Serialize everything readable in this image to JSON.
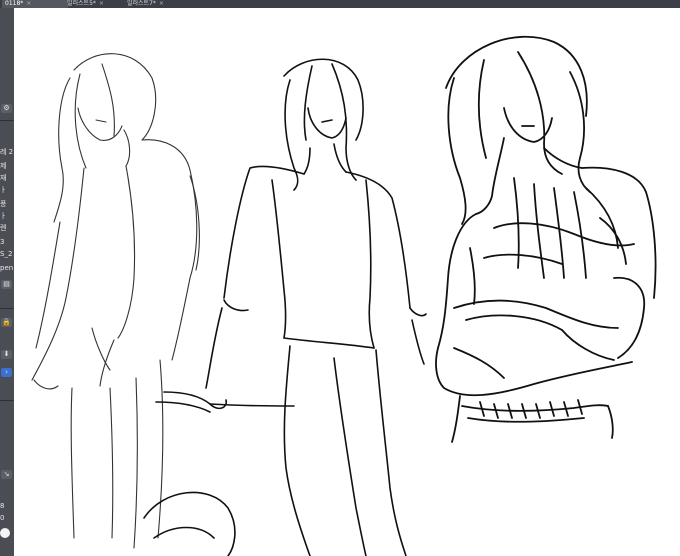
{
  "app": {
    "tabs": [
      {
        "label": "0118*",
        "active": true
      },
      {
        "label": "일러스트5*",
        "active": false
      },
      {
        "label": "일러스트7*",
        "active": false
      }
    ],
    "close_glyph": "×"
  },
  "left_panel": {
    "items": [
      {
        "label": "레 2"
      },
      {
        "label": "제"
      },
      {
        "label": "재"
      },
      {
        "label": "ㅏ"
      },
      {
        "label": "풍"
      },
      {
        "label": "ㅏ"
      },
      {
        "label": "렌"
      },
      {
        "label": "3"
      },
      {
        "label": "S_2"
      },
      {
        "label": "pen"
      }
    ],
    "icons": [
      {
        "name": "settings-icon",
        "glyph": "⚙"
      },
      {
        "name": "layer-icon",
        "glyph": "▤"
      },
      {
        "name": "lock-icon",
        "glyph": "🔒"
      },
      {
        "name": "arrow-down-icon",
        "glyph": "⬇"
      },
      {
        "name": "arrow-right-icon",
        "glyph": "›"
      },
      {
        "name": "tool-icon",
        "glyph": "↘"
      },
      {
        "name": "brush-size-icon",
        "glyph": "●"
      }
    ],
    "size_values": [
      "8",
      "0"
    ]
  },
  "colors": {
    "ink": "#111111",
    "panel": "#4a4d53",
    "tabbar": "#3c3f45",
    "accent": "#3c6fd0"
  }
}
